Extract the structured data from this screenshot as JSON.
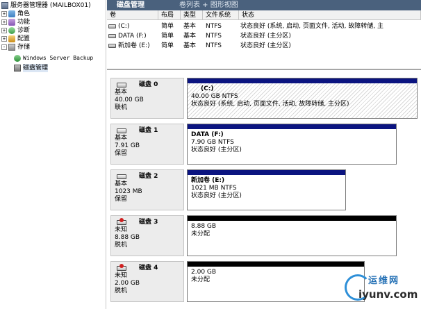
{
  "tree": {
    "root": "服务器管理器 (MAILBOX01)",
    "items": [
      {
        "label": "角色",
        "icon": "roles-icon"
      },
      {
        "label": "功能",
        "icon": "features-icon"
      },
      {
        "label": "诊断",
        "icon": "diagnostics-icon"
      },
      {
        "label": "配置",
        "icon": "configuration-icon"
      },
      {
        "label": "存储",
        "icon": "storage-icon"
      }
    ],
    "storage_children": [
      {
        "label": "Windows Server Backup",
        "icon": "backup-icon"
      },
      {
        "label": "磁盘管理",
        "icon": "disk-management-icon",
        "selected": true
      }
    ]
  },
  "header": {
    "title": "磁盘管理",
    "view": "卷列表 + 图形视图"
  },
  "volume_list": {
    "columns": [
      "卷",
      "布局",
      "类型",
      "文件系统",
      "状态"
    ],
    "rows": [
      {
        "volume": "(C:)",
        "layout": "简单",
        "type": "基本",
        "fs": "NTFS",
        "status": "状态良好 (系统, 启动, 页面文件, 活动, 故障转储, 主"
      },
      {
        "volume": "DATA (F:)",
        "layout": "简单",
        "type": "基本",
        "fs": "NTFS",
        "status": "状态良好 (主分区)"
      },
      {
        "volume": "新加卷 (E:)",
        "layout": "简单",
        "type": "基本",
        "fs": "NTFS",
        "status": "状态良好 (主分区)"
      }
    ]
  },
  "disks": [
    {
      "name": "磁盘 0",
      "kind": "基本",
      "size": "40.00 GB",
      "state": "联机",
      "offline": false,
      "partition": {
        "title": "(C:)",
        "line1": "40.00 GB NTFS",
        "line2": "状态良好 (系统, 启动, 页面文件, 活动, 故障转储, 主分区)",
        "fill": 1.0
      }
    },
    {
      "name": "磁盘 1",
      "kind": "基本",
      "size": "7.91 GB",
      "state": "保留",
      "offline": false,
      "partition": {
        "title": "DATA  (F:)",
        "line1": "7.90 GB NTFS",
        "line2": "状态良好 (主分区)",
        "fill": 0.91
      }
    },
    {
      "name": "磁盘 2",
      "kind": "基本",
      "size": "1023 MB",
      "state": "保留",
      "offline": false,
      "partition": {
        "title": "新加卷  (E:)",
        "line1": "1021 MB NTFS",
        "line2": "状态良好 (主分区)",
        "fill": 0.69
      }
    },
    {
      "name": "磁盘 3",
      "kind": "未知",
      "size": "8.88 GB",
      "state": "脱机",
      "offline": true,
      "partition": {
        "title": "",
        "line1": "8.88 GB",
        "line2": "未分配",
        "fill": 0.91
      }
    },
    {
      "name": "磁盘 4",
      "kind": "未知",
      "size": "2.00 GB",
      "state": "脱机",
      "offline": true,
      "partition": {
        "title": "",
        "line1": "2.00 GB",
        "line2": "未分配",
        "fill": 0.77
      }
    }
  ],
  "colors": {
    "primary_bar": "#0b1480",
    "unallocated_bar": "#000000",
    "title_bar": "#4a617d"
  },
  "watermark": {
    "line1": "运维网",
    "line2": "iyunv.com"
  }
}
